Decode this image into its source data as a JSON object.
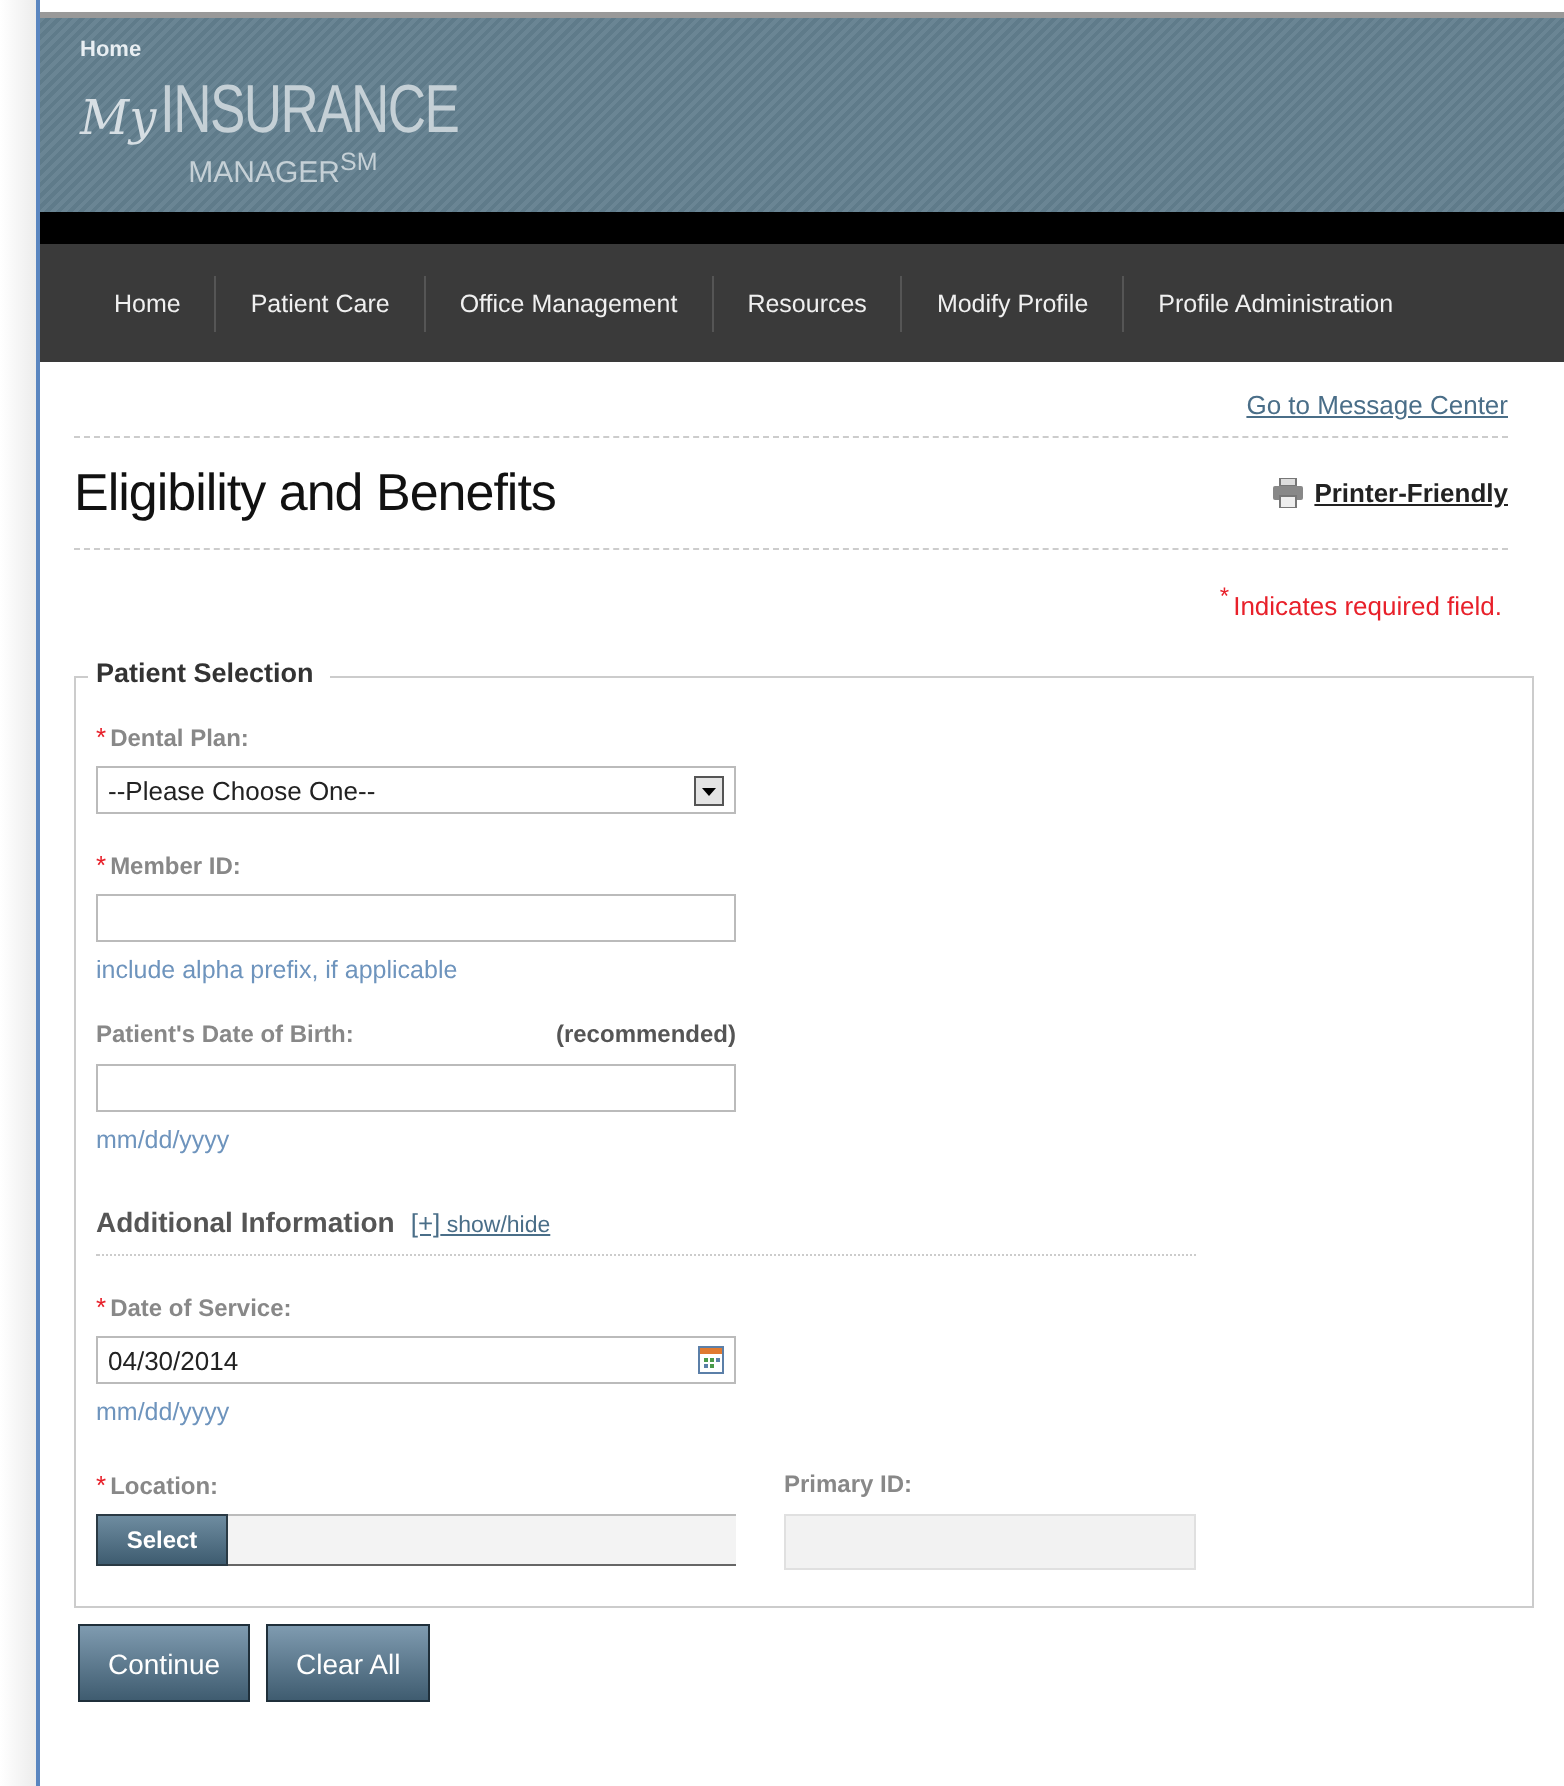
{
  "header": {
    "home_link": "Home",
    "logo_script": "My",
    "logo_main": "INSURANCE",
    "logo_sub": "MANAGER$^{SM}$"
  },
  "nav": [
    "Home",
    "Patient Care",
    "Office Management",
    "Resources",
    "Modify Profile",
    "Profile Administration"
  ],
  "message_link": "Go to Message Center",
  "page_title": "Eligibility and Benefits",
  "printer_link": "Printer-Friendly",
  "required_note": {
    "mark": "*",
    "text": "Indicates required field."
  },
  "fieldset": {
    "legend": "Patient Selection",
    "fields": [
      {
        "kind": "select",
        "label": "Dental Plan:",
        "required": true,
        "value": "--Please Choose One--"
      },
      {
        "kind": "text",
        "label": "Member ID:",
        "required": true,
        "hint": "include alpha prefix, if applicable"
      },
      {
        "kind": "text",
        "label": "Patient's Date of Birth:",
        "required": false,
        "note": "(recommended)",
        "hint": "mm/dd/yyyy"
      }
    ],
    "additional": {
      "title": "Additional Information",
      "toggle_mark": "[+]",
      "toggle_text": "show/hide"
    },
    "more_fields": [
      {
        "kind": "date",
        "label": "Date of Service:",
        "required": true,
        "value": "04/30/2014",
        "hint": "mm/dd/yyyy"
      }
    ],
    "location": {
      "label": "Location:",
      "required": true,
      "button": "Select"
    },
    "primary_id": {
      "label": "Primary ID:",
      "disabled": true
    }
  },
  "buttons": [
    "Continue",
    "Clear All"
  ]
}
